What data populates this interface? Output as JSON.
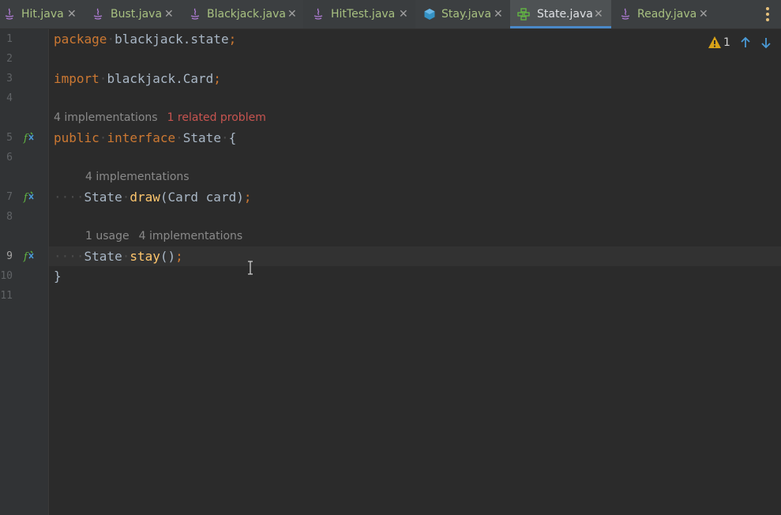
{
  "tabs": [
    {
      "label": "Hit.java",
      "icon": "java-class-icon",
      "color": "#a7c080",
      "active": false
    },
    {
      "label": "Bust.java",
      "icon": "java-class-icon",
      "color": "#a7c080",
      "active": false
    },
    {
      "label": "Blackjack.java",
      "icon": "java-class-icon",
      "color": "#a7c080",
      "active": false
    },
    {
      "label": "HitTest.java",
      "icon": "java-class-icon",
      "color": "#a7c080",
      "active": false
    },
    {
      "label": "Stay.java",
      "icon": "class-icon",
      "color": "#a7c080",
      "active": false
    },
    {
      "label": "State.java",
      "icon": "interface-icon",
      "color": "#a7c080",
      "active": true
    },
    {
      "label": "Ready.java",
      "icon": "java-class-icon",
      "color": "#a7c080",
      "active": false
    }
  ],
  "inspection": {
    "warning_count": "1"
  },
  "line_numbers": [
    "1",
    "2",
    "3",
    "4",
    "5",
    "6",
    "7",
    "8",
    "9",
    "10",
    "11"
  ],
  "current_line": "9",
  "code": {
    "line1": {
      "kw": "package",
      "rest": "blackjack.state",
      "semi": ";"
    },
    "line3": {
      "kw": "import",
      "rest": "blackjack.Card",
      "semi": ";"
    },
    "line5": {
      "kw1": "public",
      "kw2": "interface",
      "name": "State",
      "brace": "{"
    },
    "line7": {
      "type": "State",
      "method": "draw",
      "params": "(Card card)",
      "semi": ";"
    },
    "line9": {
      "type": "State",
      "method": "stay",
      "params": "()",
      "semi": ";"
    },
    "line10": {
      "brace": "}"
    }
  },
  "hints": {
    "interface": {
      "implementations": "4 implementations",
      "problem": "1 related problem"
    },
    "draw": {
      "implementations": "4 implementations"
    },
    "stay": {
      "usages": "1 usage",
      "implementations": "4 implementations"
    }
  },
  "colors": {
    "keyword": "#cc7832",
    "method": "#ffc66d",
    "text": "#a9b7c6",
    "accent": "#4a88c7",
    "warning": "#d7a218"
  }
}
